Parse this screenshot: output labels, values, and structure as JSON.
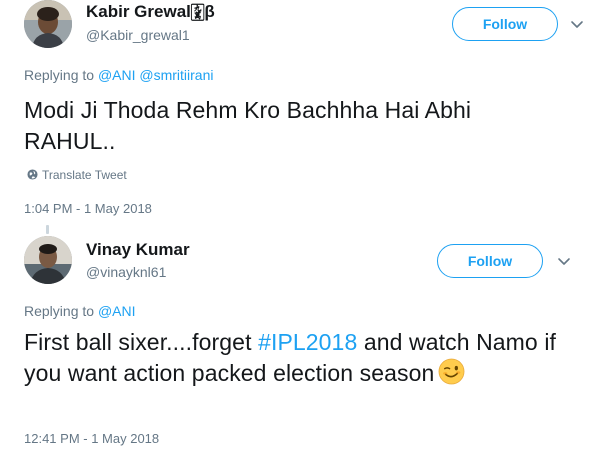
{
  "tweets": [
    {
      "name": "Kabir Grewal🀏β",
      "handle": "@Kabir_grewal1",
      "follow_label": "Follow",
      "replying_prefix": "Replying to",
      "mentions": [
        "@ANI",
        "@smritiirani"
      ],
      "text": "Modi Ji Thoda Rehm Kro Bachhha Hai Abhi RAHUL..",
      "translate_label": "Translate Tweet",
      "timestamp": "1:04 PM - 1 May 2018"
    },
    {
      "name": "Vinay Kumar",
      "handle": "@vinayknl61",
      "follow_label": "Follow",
      "replying_prefix": "Replying to",
      "mentions": [
        "@ANI"
      ],
      "text_before": "First ball sixer....forget ",
      "hashtag": "#IPL2018",
      "text_after": " and watch Namo if you want action packed election season",
      "emoji_name": "winking-face-emoji",
      "timestamp": "12:41 PM - 1 May 2018"
    }
  ],
  "colors": {
    "accent": "#1da1f2",
    "text": "#14171a",
    "secondary": "#657786",
    "thread_line": "#ccd6dd"
  },
  "icons": {
    "chevron": "chevron-down-icon",
    "globe": "globe-icon"
  }
}
